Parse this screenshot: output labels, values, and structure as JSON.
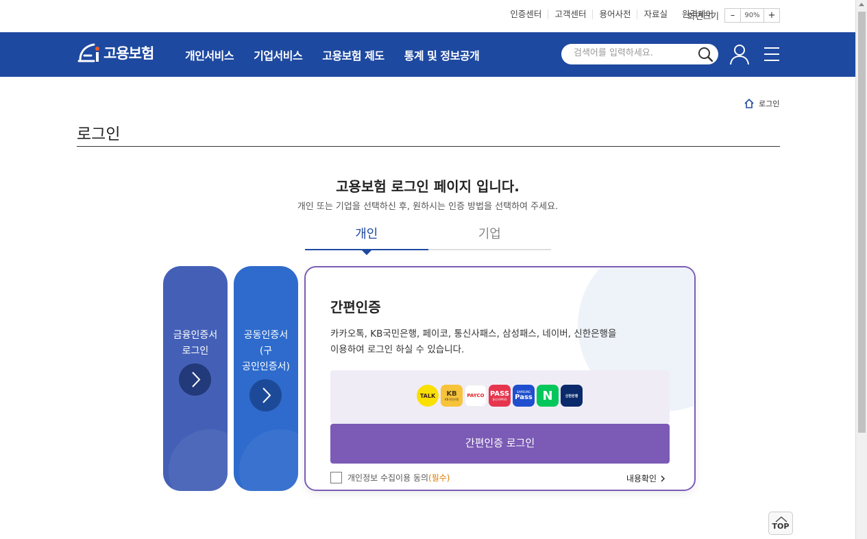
{
  "utility": {
    "links": [
      "인증센터",
      "고객센터",
      "용어사전",
      "자료실",
      "원격제어"
    ],
    "zoom_label": "화면크기",
    "zoom_minus": "–",
    "zoom_value": "90%",
    "zoom_plus": "+"
  },
  "header": {
    "logo_text": "고용보험",
    "menu": [
      "개인서비스",
      "기업서비스",
      "고용보험 제도",
      "통계 및 정보공개"
    ],
    "search_placeholder": "검색어를 입력하세요.",
    "brand_color": "#1e49a0"
  },
  "breadcrumb": {
    "current": "로그인"
  },
  "page_title": "로그인",
  "intro": {
    "heading": "고용보험 로그인 페이지 입니다.",
    "subheading": "개인 또는 기업을 선택하신 후, 원하시는 인증 방법을 선택하여 주세요."
  },
  "tabs": [
    {
      "label": "개인",
      "active": true
    },
    {
      "label": "기업",
      "active": false
    }
  ],
  "login_options": {
    "financial_cert": {
      "line1": "금융인증서",
      "line2": "로그인"
    },
    "joint_cert": {
      "line1": "공동인증서",
      "line2": "(구",
      "line3": "공인인증서)"
    }
  },
  "simple_auth": {
    "title": "간편인증",
    "description_line1": "카카오톡, KB국민은행, 페이코, 통신사패스, 삼성패스, 네이버, 신한은행을",
    "description_line2": "이용하여 로그인 하실 수 있습니다.",
    "providers": [
      {
        "name": "kakaotalk",
        "text": "TALK",
        "bg": "#f9e000",
        "fg": "#3a1d1d"
      },
      {
        "name": "kb",
        "text": "KB",
        "sub": "KB국민은행",
        "bg": "#f7c33a",
        "fg": "#4a3a1a"
      },
      {
        "name": "payco",
        "text": "PAYCO",
        "bg": "#ffffff",
        "fg": "#e3242b"
      },
      {
        "name": "pass",
        "text": "PASS",
        "sub": "통신사PASS",
        "bg": "#e6364e",
        "fg": "#ffffff"
      },
      {
        "name": "samsung-pass",
        "text": "Pass",
        "sub": "SAMSUNG",
        "bg": "#1f4fcf",
        "fg": "#ffffff"
      },
      {
        "name": "naver",
        "text": "N",
        "bg": "#03c75a",
        "fg": "#ffffff"
      },
      {
        "name": "shinhan",
        "text": "신한은행",
        "bg": "#0a2a6b",
        "fg": "#ffffff"
      }
    ],
    "login_button": "간편인증 로그인",
    "agree_text": "개인정보 수집이용 동의",
    "agree_required": "(필수)",
    "detail_link": "내용확인",
    "accent_color": "#7b5bb5"
  },
  "top_button": "TOP"
}
